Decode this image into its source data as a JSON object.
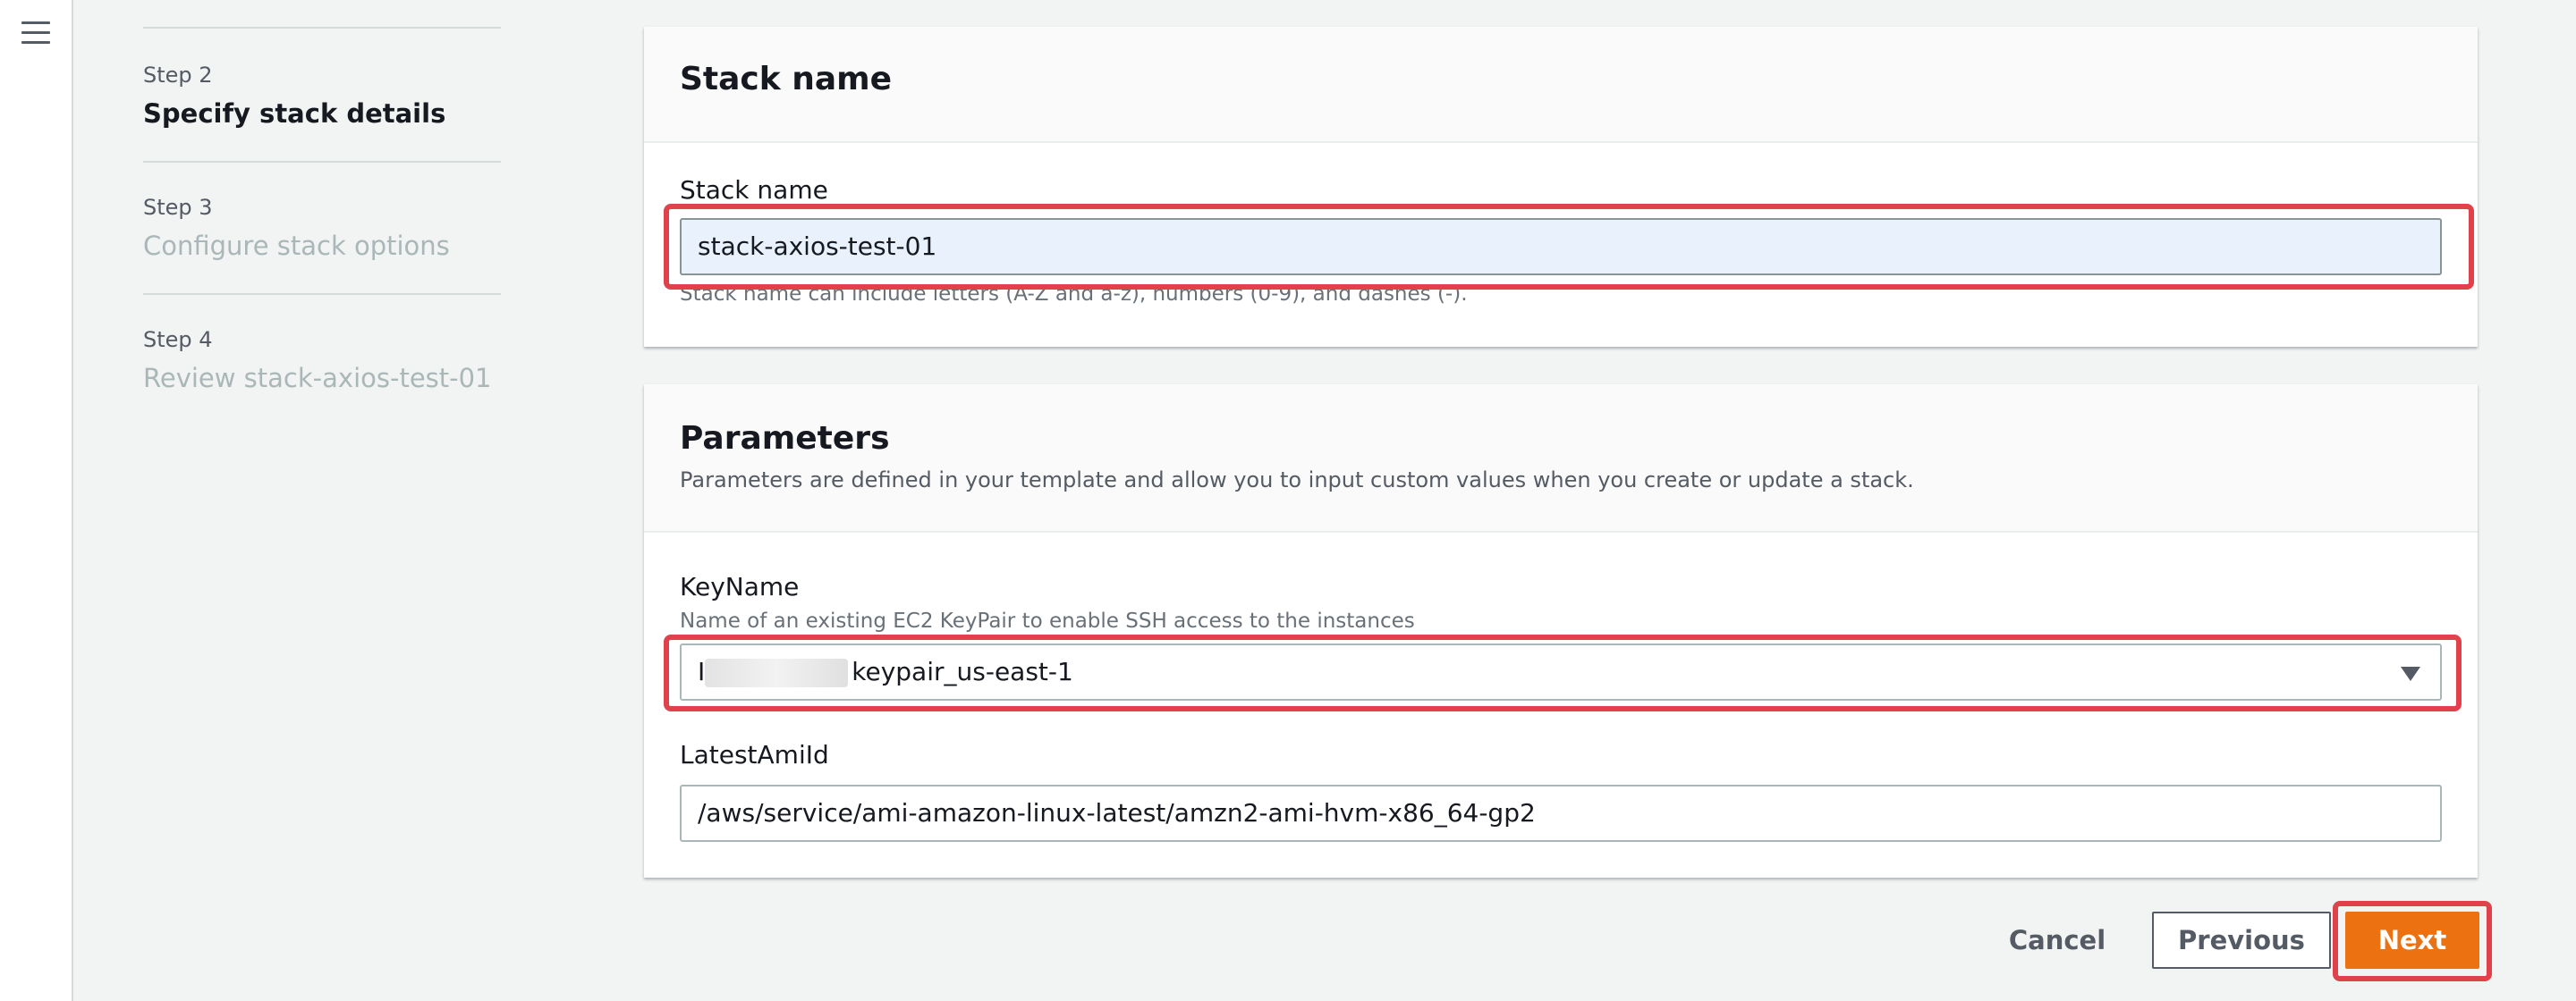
{
  "nav": {
    "menu_icon": "hamburger-menu-icon"
  },
  "steps": [
    {
      "label": "Step 2",
      "title": "Specify stack details",
      "state": "active"
    },
    {
      "label": "Step 3",
      "title": "Configure stack options",
      "state": "inactive"
    },
    {
      "label": "Step 4",
      "title": "Review stack-axios-test-01",
      "state": "inactive"
    }
  ],
  "stack_name_panel": {
    "title": "Stack name",
    "field_label": "Stack name",
    "value": "stack-axios-test-01",
    "hint": "Stack name can include letters (A-Z and a-z), numbers (0-9), and dashes (-)."
  },
  "parameters_panel": {
    "title": "Parameters",
    "description": "Parameters are defined in your template and allow you to input custom values when you create or update a stack.",
    "keyname": {
      "label": "KeyName",
      "description": "Name of an existing EC2 KeyPair to enable SSH access to the instances",
      "value_prefix": "I",
      "value_suffix": "keypair_us-east-1"
    },
    "latestamiid": {
      "label": "LatestAmiId",
      "value": "/aws/service/ami-amazon-linux-latest/amzn2-ami-hvm-x86_64-gp2"
    }
  },
  "actions": {
    "cancel": "Cancel",
    "previous": "Previous",
    "next": "Next"
  },
  "colors": {
    "primary_button": "#ec7211",
    "highlight_box": "#e0414b",
    "focused_input_bg": "#e9f2fc"
  }
}
